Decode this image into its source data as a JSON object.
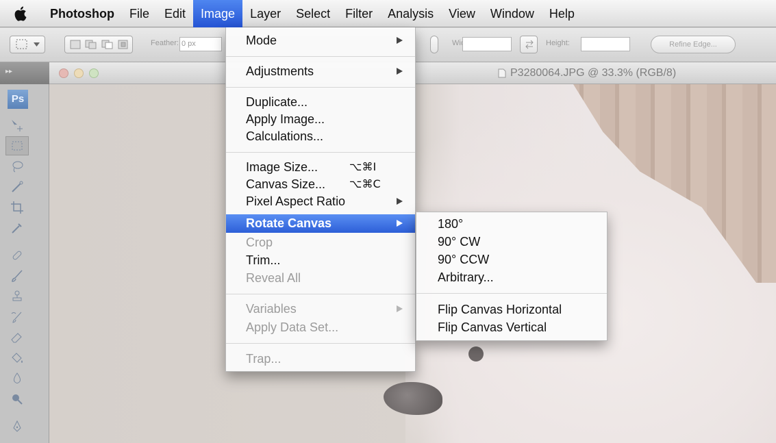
{
  "menubar": {
    "app": "Photoshop",
    "items": [
      "File",
      "Edit",
      "Image",
      "Layer",
      "Select",
      "Filter",
      "Analysis",
      "View",
      "Window",
      "Help"
    ]
  },
  "options_bar": {
    "feather_label": "Feather:",
    "feather_value": "0 px",
    "width_label": "Width:",
    "height_label": "Height:",
    "refine_edge": "Refine Edge..."
  },
  "document": {
    "title": "P3280064.JPG @ 33.3% (RGB/8)"
  },
  "tools": {
    "logo": "Ps"
  },
  "image_menu": {
    "mode": "Mode",
    "adjustments": "Adjustments",
    "duplicate": "Duplicate...",
    "apply_image": "Apply Image...",
    "calculations": "Calculations...",
    "image_size": "Image Size...",
    "image_size_shortcut": "⌥⌘I",
    "canvas_size": "Canvas Size...",
    "canvas_size_shortcut": "⌥⌘C",
    "pixel_aspect_ratio": "Pixel Aspect Ratio",
    "rotate_canvas": "Rotate Canvas",
    "crop": "Crop",
    "trim": "Trim...",
    "reveal_all": "Reveal All",
    "variables": "Variables",
    "apply_data_set": "Apply Data Set...",
    "trap": "Trap..."
  },
  "rotate_menu": {
    "r180": "180°",
    "cw": "90° CW",
    "ccw": "90° CCW",
    "arbitrary": "Arbitrary...",
    "flip_h": "Flip Canvas Horizontal",
    "flip_v": "Flip Canvas Vertical"
  },
  "colors": {
    "highlight": "#2d5fd8",
    "ps_logo": "#5b83b8"
  }
}
